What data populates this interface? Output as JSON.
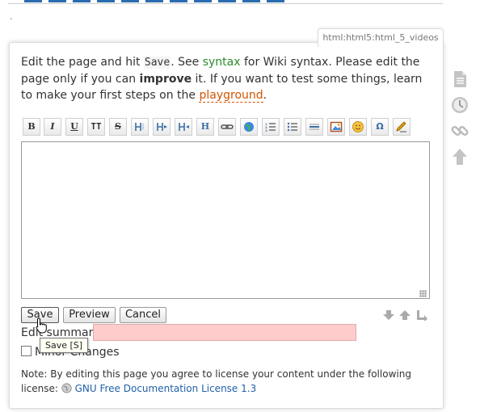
{
  "page": {
    "tab_label": "html:html5:html_5_videos",
    "dot": "."
  },
  "intro": {
    "t1": "Edit the page and hit ",
    "save_code": "Save",
    "t2": ". See ",
    "syntax": "syntax",
    "t3": " for Wiki syntax. Please edit the page only if you can ",
    "improve": "improve",
    "t4": " it. If you want to test some things, learn to make your first steps on the ",
    "playground": "playground",
    "t5": "."
  },
  "toolbar": {
    "bold": "B",
    "italic": "I",
    "underline": "U",
    "code": "TT",
    "strike": "S",
    "heading": "H"
  },
  "editor": {
    "value": ""
  },
  "buttons": {
    "save": "Save",
    "preview": "Preview",
    "cancel": "Cancel"
  },
  "summary": {
    "label": "Edit summary",
    "value": ""
  },
  "minor": {
    "label": "Minor Changes",
    "checked": false
  },
  "tooltip": {
    "text": "Save [S]"
  },
  "note": {
    "text": "Note: By editing this page you agree to license your content under the following license:",
    "license": "GNU Free Documentation License 1.3"
  },
  "colors": {
    "summary_bg": "#ffcccc",
    "syntax_link": "#2a8a2a",
    "playground_link": "#d35400",
    "license_link": "#1f5fa8"
  }
}
